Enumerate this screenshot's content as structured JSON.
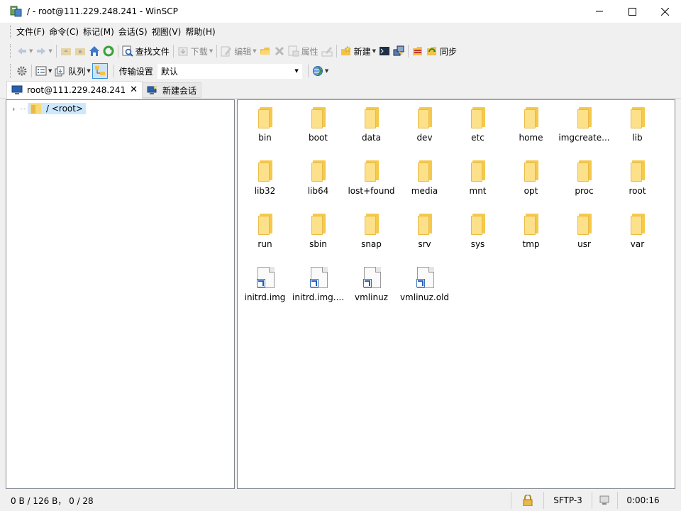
{
  "window": {
    "title": "/ - root@111.229.248.241 - WinSCP",
    "controls": [
      "minimize",
      "maximize",
      "close"
    ]
  },
  "menu": [
    "文件(F)",
    "命令(C)",
    "标记(M)",
    "会话(S)",
    "视图(V)",
    "帮助(H)"
  ],
  "toolbar1": {
    "find_files": "查找文件",
    "download": "下载",
    "edit": "编辑",
    "properties": "属性",
    "new": "新建",
    "sync": "同步"
  },
  "toolbar2": {
    "queue": "队列",
    "transfer_settings_label": "传输设置",
    "transfer_settings_value": "默认"
  },
  "tabs": {
    "session": "root@111.229.248.241",
    "new_session": "新建会话"
  },
  "tree": {
    "root_label": "/ <root>"
  },
  "files": [
    {
      "name": "bin",
      "type": "folder"
    },
    {
      "name": "boot",
      "type": "folder"
    },
    {
      "name": "data",
      "type": "folder"
    },
    {
      "name": "dev",
      "type": "folder"
    },
    {
      "name": "etc",
      "type": "folder"
    },
    {
      "name": "home",
      "type": "folder"
    },
    {
      "name": "imgcreate...",
      "type": "folder"
    },
    {
      "name": "lib",
      "type": "folder"
    },
    {
      "name": "lib32",
      "type": "folder"
    },
    {
      "name": "lib64",
      "type": "folder"
    },
    {
      "name": "lost+found",
      "type": "folder"
    },
    {
      "name": "media",
      "type": "folder"
    },
    {
      "name": "mnt",
      "type": "folder"
    },
    {
      "name": "opt",
      "type": "folder"
    },
    {
      "name": "proc",
      "type": "folder"
    },
    {
      "name": "root",
      "type": "folder"
    },
    {
      "name": "run",
      "type": "folder"
    },
    {
      "name": "sbin",
      "type": "folder"
    },
    {
      "name": "snap",
      "type": "folder"
    },
    {
      "name": "srv",
      "type": "folder"
    },
    {
      "name": "sys",
      "type": "folder"
    },
    {
      "name": "tmp",
      "type": "folder"
    },
    {
      "name": "usr",
      "type": "folder"
    },
    {
      "name": "var",
      "type": "folder"
    },
    {
      "name": "initrd.img",
      "type": "link"
    },
    {
      "name": "initrd.img....",
      "type": "link"
    },
    {
      "name": "vmlinuz",
      "type": "link"
    },
    {
      "name": "vmlinuz.old",
      "type": "link"
    }
  ],
  "status": {
    "selection": "0 B / 126 B， 0 / 28",
    "protocol": "SFTP-3",
    "elapsed": "0:00:16"
  },
  "colors": {
    "folder": "#fde08a",
    "selection": "#cce8ff",
    "pane_border": "#828790"
  }
}
